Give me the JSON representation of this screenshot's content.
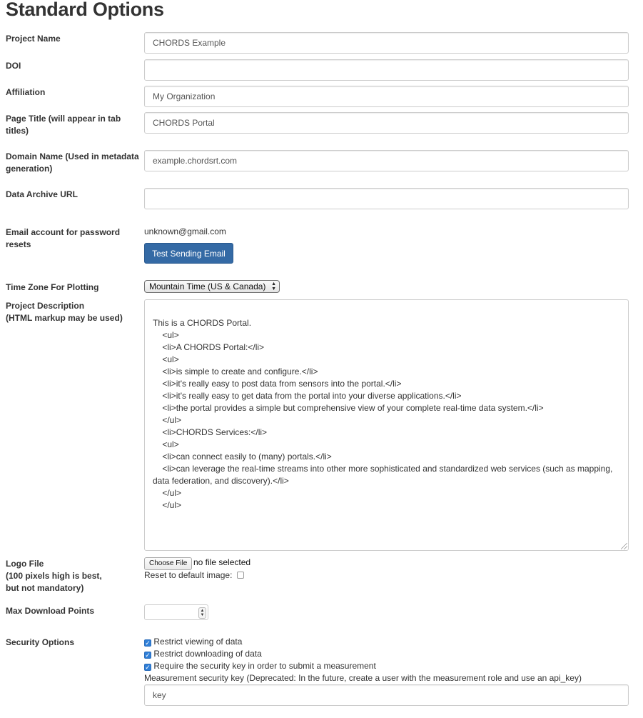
{
  "page": {
    "title": "Standard Options"
  },
  "fields": {
    "project_name": {
      "label": "Project Name",
      "value": "CHORDS Example"
    },
    "doi": {
      "label": "DOI",
      "value": ""
    },
    "affiliation": {
      "label": "Affiliation",
      "value": "My Organization"
    },
    "page_title": {
      "label": "Page Title (will appear in tab titles)",
      "value": "CHORDS Portal"
    },
    "domain_name": {
      "label": "Domain Name (Used in metadata generation)",
      "value": "example.chordsrt.com"
    },
    "data_archive_url": {
      "label": "Data Archive URL",
      "value": ""
    },
    "email": {
      "label": "Email account for password resets",
      "value": "unknown@gmail.com",
      "button": "Test Sending Email"
    },
    "time_zone": {
      "label": "Time Zone For Plotting",
      "value": "Mountain Time (US & Canada)"
    },
    "project_description": {
      "label_line1": "Project Description",
      "label_line2": "(HTML markup may be used)",
      "value": "This is a CHORDS Portal.\n    <ul>\n    <li>A CHORDS Portal:</li>\n    <ul>\n    <li>is simple to create and configure.</li>\n    <li>it's really easy to post data from sensors into the portal.</li>\n    <li>it's really easy to get data from the portal into your diverse applications.</li>\n    <li>the portal provides a simple but comprehensive view of your complete real-time data system.</li>\n    </ul>\n    <li>CHORDS Services:</li>\n    <ul>\n    <li>can connect easily to (many) portals.</li>\n    <li>can leverage the real-time streams into other more sophisticated and standardized web services (such as mapping, data federation, and discovery).</li>\n    </ul>\n    </ul>"
    },
    "logo_file": {
      "label_line1": "Logo File",
      "label_line2": "(100 pixels high is best,",
      "label_line3": "but not mandatory)",
      "choose_button": "Choose File",
      "status": "no file selected",
      "reset_label": "Reset to default image:"
    },
    "max_download_points": {
      "label": "Max Download Points",
      "value": ""
    },
    "security": {
      "label": "Security Options",
      "restrict_viewing": {
        "label": "Restrict viewing of data",
        "checked": true
      },
      "restrict_downloading": {
        "label": "Restrict downloading of data",
        "checked": true
      },
      "require_key": {
        "label": "Require the security key in order to submit a measurement",
        "checked": true
      },
      "key_label": "Measurement security key (Deprecated: In the future, create a user with the measurement role and use an api_key)",
      "key_value": "key"
    }
  },
  "colors": {
    "primary_button": "#346aa5",
    "checkbox_checked": "#2f7fd8",
    "input_border": "#cccccc"
  },
  "icons": {
    "select_arrows": "up-down-arrows-icon",
    "check": "checkmark-icon",
    "resize": "resize-grip-icon"
  }
}
